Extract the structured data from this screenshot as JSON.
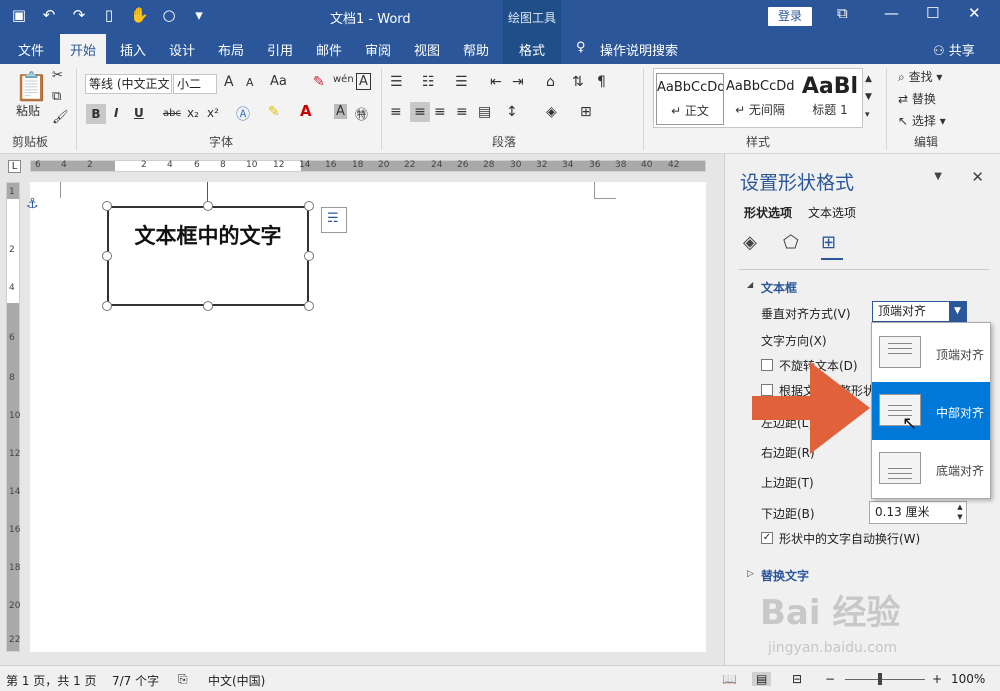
{
  "titlebar": {
    "doc_title": "文档1  -  Word",
    "context_group": "绘图工具",
    "login": "登录",
    "qat_icons": [
      "save-icon",
      "undo-icon",
      "redo-icon",
      "new-doc-icon",
      "touch-mode-icon",
      "shape-icon",
      "more-icon"
    ]
  },
  "tabs": {
    "file": "文件",
    "home": "开始",
    "insert": "插入",
    "design": "设计",
    "layout": "布局",
    "references": "引用",
    "mailings": "邮件",
    "review": "审阅",
    "view": "视图",
    "help": "帮助",
    "format": "格式",
    "tell_me": "操作说明搜索",
    "share": "共享"
  },
  "ribbon": {
    "clipboard": {
      "paste": "粘贴",
      "label": "剪贴板"
    },
    "font": {
      "font_name": "等线 (中文正文",
      "font_size": "小二",
      "grow": "A",
      "shrink": "A",
      "case": "Aa",
      "bold": "B",
      "italic": "I",
      "underline": "U",
      "strike": "abc",
      "sub": "x₂",
      "sup": "x²",
      "label": "字体"
    },
    "paragraph": {
      "label": "段落"
    },
    "styles": {
      "items": [
        {
          "preview": "AaBbCcDd",
          "name": "↵ 正文"
        },
        {
          "preview": "AaBbCcDd",
          "name": "↵ 无间隔"
        },
        {
          "preview": "AaBl",
          "name": "标题 1"
        }
      ],
      "label": "样式"
    },
    "editing": {
      "find": "查找",
      "replace": "替换",
      "select": "选择",
      "label": "编辑"
    }
  },
  "ruler": {
    "h_ticks": [
      "6",
      "4",
      "2",
      "2",
      "4",
      "6",
      "8",
      "10",
      "12",
      "14",
      "16",
      "18",
      "20",
      "22",
      "24",
      "26",
      "28",
      "30",
      "32",
      "34",
      "36",
      "38",
      "40",
      "42"
    ],
    "v_ticks": [
      "1",
      "2",
      "4",
      "6",
      "8",
      "10",
      "12",
      "14",
      "16",
      "18",
      "20",
      "22"
    ]
  },
  "document": {
    "textbox_text": "文本框中的文字"
  },
  "pane": {
    "title": "设置形状格式",
    "tab_shape": "形状选项",
    "tab_text": "文本选项",
    "section_textbox": "文本框",
    "valign_label": "垂直对齐方式(V)",
    "valign_value": "顶端对齐",
    "text_direction_label": "文字方向(X)",
    "no_rotate_label": "不旋转文本(D)",
    "resize_label": "根据文字调整形状大小",
    "left_margin_label": "左边距(L)",
    "right_margin_label": "右边距(R)",
    "top_margin_label": "上边距(T)",
    "bottom_margin_label": "下边距(B)",
    "bottom_margin_value": "0.13 厘米",
    "wrap_label": "形状中的文字自动换行(W)",
    "alt_text": "替换文字"
  },
  "dropdown": {
    "options": [
      "顶端对齐",
      "中部对齐",
      "底端对齐"
    ],
    "highlighted": "中部对齐"
  },
  "statusbar": {
    "page": "第 1 页，共 1 页",
    "words": "7/7 个字",
    "language": "中文(中国)",
    "zoom": "100%"
  },
  "watermark": {
    "brand": "Bai 经验",
    "url": "jingyan.baidu.com"
  },
  "colors": {
    "brand_blue": "#2b579a",
    "highlight": "#0078d7",
    "arrow": "#e0613a"
  }
}
